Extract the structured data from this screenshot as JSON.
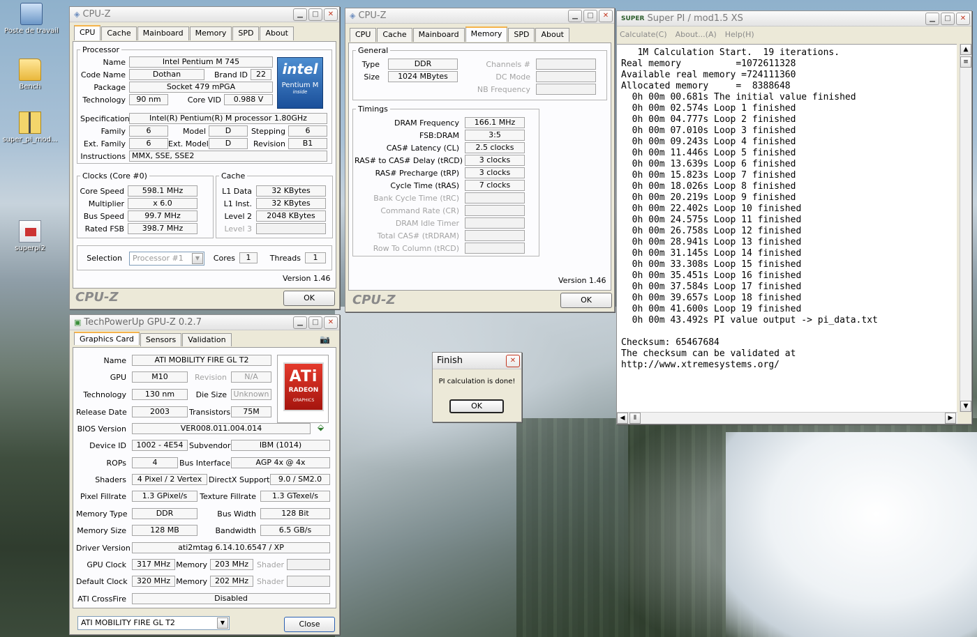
{
  "desktop": {
    "icons": [
      {
        "label": "Poste de travail",
        "icon": "computer-icon"
      },
      {
        "label": "Bench",
        "icon": "folder-icon"
      },
      {
        "label": "super_pi_mod...",
        "icon": "zip-folder-icon"
      },
      {
        "label": "superpi2",
        "icon": "exe-icon"
      }
    ]
  },
  "cpuz1": {
    "title": "CPU-Z",
    "tabs": [
      "CPU",
      "Cache",
      "Mainboard",
      "Memory",
      "SPD",
      "About"
    ],
    "processor_legend": "Processor",
    "name_label": "Name",
    "name": "Intel Pentium M 745",
    "codename_label": "Code Name",
    "codename": "Dothan",
    "brandid_label": "Brand ID",
    "brandid": "22",
    "package_label": "Package",
    "package": "Socket 479 mPGA",
    "technology_label": "Technology",
    "technology": "90 nm",
    "corevid_label": "Core VID",
    "corevid": "0.988 V",
    "spec_label": "Specification",
    "spec": "Intel(R) Pentium(R) M processor 1.80GHz",
    "family_label": "Family",
    "family": "6",
    "model_label": "Model",
    "model": "D",
    "stepping_label": "Stepping",
    "stepping": "6",
    "extfamily_label": "Ext. Family",
    "extfamily": "6",
    "extmodel_label": "Ext. Model",
    "extmodel": "D",
    "revision_label": "Revision",
    "revision": "B1",
    "instructions_label": "Instructions",
    "instructions": "MMX, SSE, SSE2",
    "clocks_legend": "Clocks (Core #0)",
    "corespeed_label": "Core Speed",
    "corespeed": "598.1 MHz",
    "multiplier_label": "Multiplier",
    "multiplier": "x 6.0",
    "busspeed_label": "Bus Speed",
    "busspeed": "99.7 MHz",
    "ratedfsb_label": "Rated FSB",
    "ratedfsb": "398.7 MHz",
    "cache_legend": "Cache",
    "l1data_label": "L1 Data",
    "l1data": "32 KBytes",
    "l1inst_label": "L1 Inst.",
    "l1inst": "32 KBytes",
    "level2_label": "Level 2",
    "level2": "2048 KBytes",
    "level3_label": "Level 3",
    "selection_label": "Selection",
    "selection": "Processor #1",
    "cores_label": "Cores",
    "cores": "1",
    "threads_label": "Threads",
    "threads": "1",
    "version": "Version 1.46",
    "brand": "CPU-Z",
    "ok": "OK",
    "intel_logo": {
      "line1": "intel",
      "line2": "Pentium M",
      "line3": "inside"
    }
  },
  "cpuz2": {
    "title": "CPU-Z",
    "tabs": [
      "CPU",
      "Cache",
      "Mainboard",
      "Memory",
      "SPD",
      "About"
    ],
    "general_legend": "General",
    "type_label": "Type",
    "type": "DDR",
    "size_label": "Size",
    "size": "1024 MBytes",
    "channels_label": "Channels #",
    "dcmode_label": "DC Mode",
    "nbfreq_label": "NB Frequency",
    "timings_legend": "Timings",
    "timings": [
      {
        "label": "DRAM Frequency",
        "value": "166.1 MHz",
        "disabled": false
      },
      {
        "label": "FSB:DRAM",
        "value": "3:5",
        "disabled": false
      },
      {
        "label": "CAS# Latency (CL)",
        "value": "2.5 clocks",
        "disabled": false
      },
      {
        "label": "RAS# to CAS# Delay (tRCD)",
        "value": "3 clocks",
        "disabled": false
      },
      {
        "label": "RAS# Precharge (tRP)",
        "value": "3 clocks",
        "disabled": false
      },
      {
        "label": "Cycle Time (tRAS)",
        "value": "7 clocks",
        "disabled": false
      },
      {
        "label": "Bank Cycle Time (tRC)",
        "value": "",
        "disabled": true
      },
      {
        "label": "Command Rate (CR)",
        "value": "",
        "disabled": true
      },
      {
        "label": "DRAM Idle Timer",
        "value": "",
        "disabled": true
      },
      {
        "label": "Total CAS# (tRDRAM)",
        "value": "",
        "disabled": true
      },
      {
        "label": "Row To Column (tRCD)",
        "value": "",
        "disabled": true
      }
    ],
    "version": "Version 1.46",
    "brand": "CPU-Z",
    "ok": "OK"
  },
  "superpi": {
    "title": "Super PI / mod1.5 XS",
    "icon_label": "SUPER",
    "menu": [
      "Calculate(C)",
      "About...(A)",
      "Help(H)"
    ],
    "lines": [
      "   1M Calculation Start.  19 iterations.",
      "Real memory          =1072611328",
      "Available real memory =724111360",
      "Allocated memory     =  8388648",
      "  0h 00m 00.681s The initial value finished",
      "  0h 00m 02.574s Loop 1 finished",
      "  0h 00m 04.777s Loop 2 finished",
      "  0h 00m 07.010s Loop 3 finished",
      "  0h 00m 09.243s Loop 4 finished",
      "  0h 00m 11.446s Loop 5 finished",
      "  0h 00m 13.639s Loop 6 finished",
      "  0h 00m 15.823s Loop 7 finished",
      "  0h 00m 18.026s Loop 8 finished",
      "  0h 00m 20.219s Loop 9 finished",
      "  0h 00m 22.402s Loop 10 finished",
      "  0h 00m 24.575s Loop 11 finished",
      "  0h 00m 26.758s Loop 12 finished",
      "  0h 00m 28.941s Loop 13 finished",
      "  0h 00m 31.145s Loop 14 finished",
      "  0h 00m 33.308s Loop 15 finished",
      "  0h 00m 35.451s Loop 16 finished",
      "  0h 00m 37.584s Loop 17 finished",
      "  0h 00m 39.657s Loop 18 finished",
      "  0h 00m 41.600s Loop 19 finished",
      "  0h 00m 43.492s PI value output -> pi_data.txt",
      "",
      "Checksum: 65467684",
      "The checksum can be validated at",
      "http://www.xtremesystems.org/"
    ]
  },
  "finish": {
    "title": "Finish",
    "message": "PI calculation is done!",
    "ok": "OK"
  },
  "gpuz": {
    "title": "TechPowerUp GPU-Z 0.2.7",
    "tabs": [
      "Graphics Card",
      "Sensors",
      "Validation"
    ],
    "name_label": "Name",
    "name": "ATI MOBILITY FIRE GL T2",
    "gpu_label": "GPU",
    "gpu": "M10",
    "revision_label": "Revision",
    "revision": "N/A",
    "technology_label": "Technology",
    "technology": "130 nm",
    "diesize_label": "Die Size",
    "diesize": "Unknown",
    "releasedate_label": "Release Date",
    "releasedate": "2003",
    "transistors_label": "Transistors",
    "transistors": "75M",
    "bios_label": "BIOS Version",
    "bios": "VER008.011.004.014",
    "deviceid_label": "Device ID",
    "deviceid": "1002 - 4E54",
    "subvendor_label": "Subvendor",
    "subvendor": "IBM (1014)",
    "rops_label": "ROPs",
    "rops": "4",
    "businterface_label": "Bus Interface",
    "businterface": "AGP 4x @ 4x",
    "shaders_label": "Shaders",
    "shaders": "4 Pixel / 2 Vertex",
    "directx_label": "DirectX Support",
    "directx": "9.0 / SM2.0",
    "pixelfill_label": "Pixel Fillrate",
    "pixelfill": "1.3 GPixel/s",
    "texturefill_label": "Texture Fillrate",
    "texturefill": "1.3 GTexel/s",
    "memtype_label": "Memory Type",
    "memtype": "DDR",
    "buswidth_label": "Bus Width",
    "buswidth": "128 Bit",
    "memsize_label": "Memory Size",
    "memsize": "128 MB",
    "bandwidth_label": "Bandwidth",
    "bandwidth": "6.5 GB/s",
    "driver_label": "Driver Version",
    "driver": "ati2mtag 6.14.10.6547  / XP",
    "gpuclock_label": "GPU Clock",
    "gpuclock": "317 MHz",
    "memory_label": "Memory",
    "memclock": "203 MHz",
    "shader_label": "Shader",
    "defclock_label": "Default Clock",
    "defclock": "320 MHz",
    "defmem": "202 MHz",
    "crossfire_label": "ATI CrossFire",
    "crossfire": "Disabled",
    "card_select": "ATI MOBILITY FIRE GL T2",
    "close": "Close",
    "ati_logo": {
      "line1": "ATi",
      "line2": "RADEON",
      "line3": "GRAPHICS"
    }
  }
}
